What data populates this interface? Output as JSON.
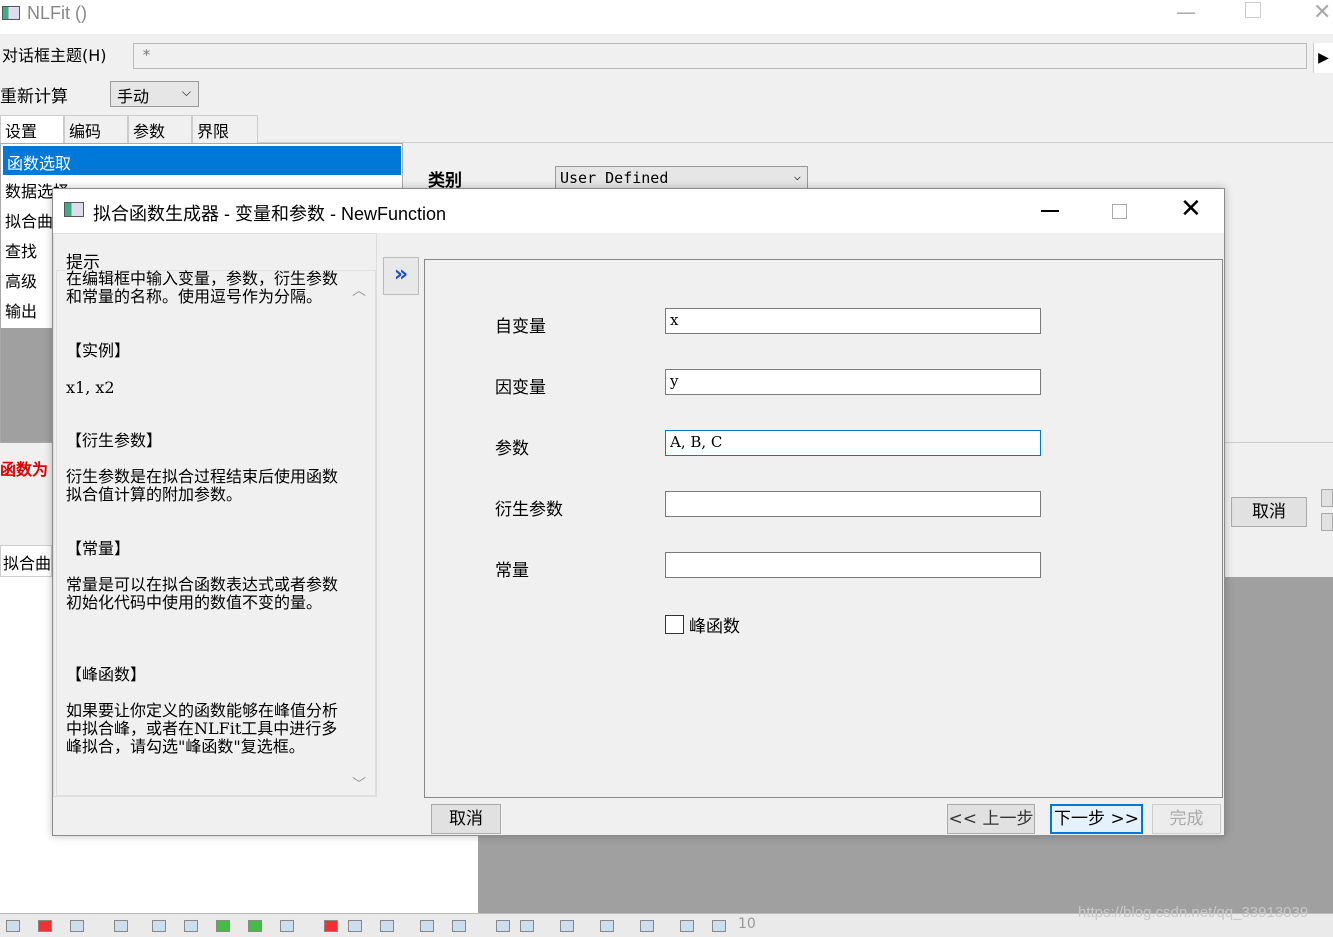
{
  "background": {
    "window_title": "NLFit ()",
    "theme_label": "对话框主题(H)",
    "theme_value": "*",
    "recalc_label": "重新计算",
    "recalc_value": "手动",
    "tabs": [
      "设置",
      "编码",
      "参数",
      "界限"
    ],
    "list_items": [
      "函数选取",
      "数据选择",
      "拟合曲",
      "查找",
      "高级",
      "输出"
    ],
    "category_label": "类别",
    "category_value": "User Defined",
    "red_text": "函数为",
    "cancel_label": "取消",
    "fit_label": "拟合曲",
    "taskbar_number": "10",
    "watermark": "https://blog.csdn.net/qq_33913039"
  },
  "dialog": {
    "title": "拟合函数生成器 - 变量和参数 - NewFunction",
    "hint": {
      "title": "提示",
      "intro": "在编辑框中输入变量，参数，衍生参数和常量的名称。使用逗号作为分隔。",
      "example_heading": "【实例】",
      "example_text": "x1, x2",
      "derived_heading": "【衍生参数】",
      "derived_text": "衍生参数是在拟合过程结束后使用函数拟合值计算的附加参数。",
      "const_heading": "【常量】",
      "const_text": "常量是可以在拟合函数表达式或者参数初始化代码中使用的数值不变的量。",
      "peak_heading": "【峰函数】",
      "peak_text": "如果要让你定义的函数能够在峰值分析中拟合峰，或者在NLFit工具中进行多峰拟合，请勾选\"峰函数\"复选框。"
    },
    "expand_glyph": "»",
    "fields": {
      "independent_label": "自变量",
      "independent_value": "x",
      "dependent_label": "因变量",
      "dependent_value": "y",
      "params_label": "参数",
      "params_value": "A, B, C",
      "derived_label": "衍生参数",
      "derived_value": "",
      "const_label": "常量",
      "const_value": ""
    },
    "peak_checkbox_label": "峰函数",
    "peak_checked": false,
    "buttons": {
      "cancel": "取消",
      "prev": "<< 上一步",
      "next": "下一步 >>",
      "finish": "完成"
    },
    "accent_color": "#0078d7"
  }
}
